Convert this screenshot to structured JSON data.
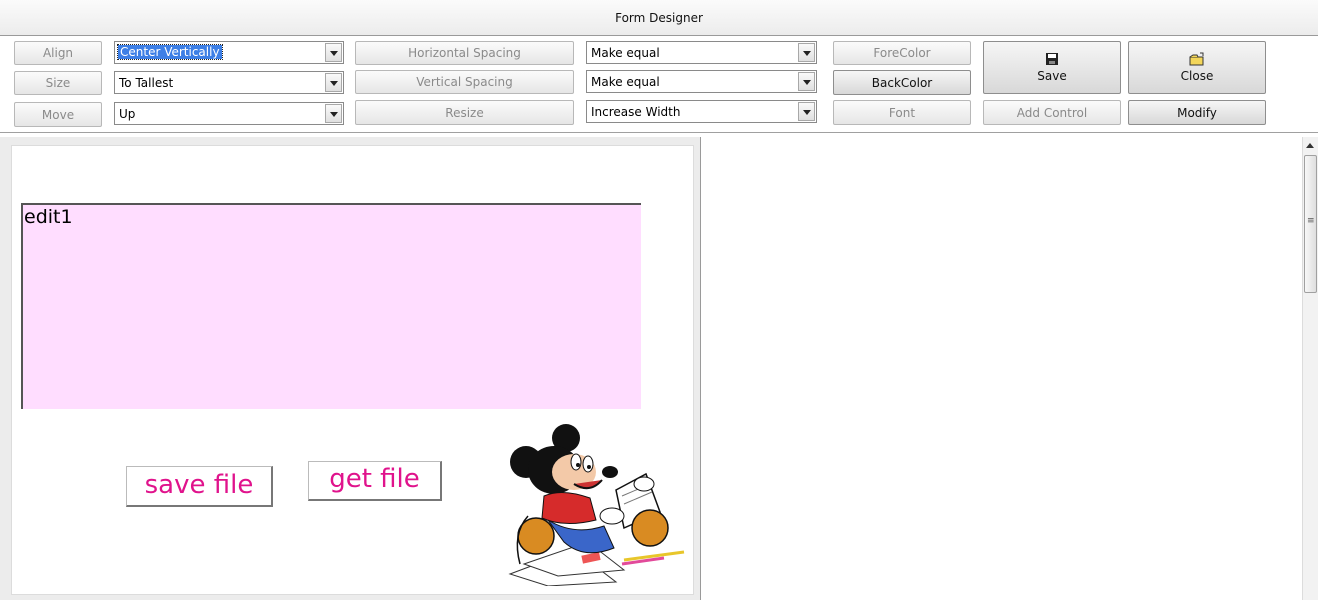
{
  "window": {
    "title": "Form Designer"
  },
  "toolbar": {
    "align_label": "Align",
    "size_label": "Size",
    "move_label": "Move",
    "align_combo": "Center Vertically",
    "size_combo": "To Tallest",
    "move_combo": "Up",
    "hspacing_label": "Horizontal Spacing",
    "vspacing_label": "Vertical Spacing",
    "resize_label": "Resize",
    "hspacing_combo": "Make equal",
    "vspacing_combo": "Make equal",
    "resize_combo": "Increase Width",
    "forecolor_label": "ForeColor",
    "backcolor_label": "BackColor",
    "font_label": "Font",
    "save_label": "Save",
    "close_label": "Close",
    "add_control_label": "Add Control",
    "modify_label": "Modify"
  },
  "form": {
    "edit1_text": "edit1",
    "edit1_color": "#ffddff",
    "save_file_label": "save file",
    "get_file_label": "get file",
    "button_text_color": "#e0138c",
    "image": "mickey-mouse-reading"
  },
  "icons": {
    "save": "floppy-disk-icon",
    "close": "folder-open-icon"
  }
}
